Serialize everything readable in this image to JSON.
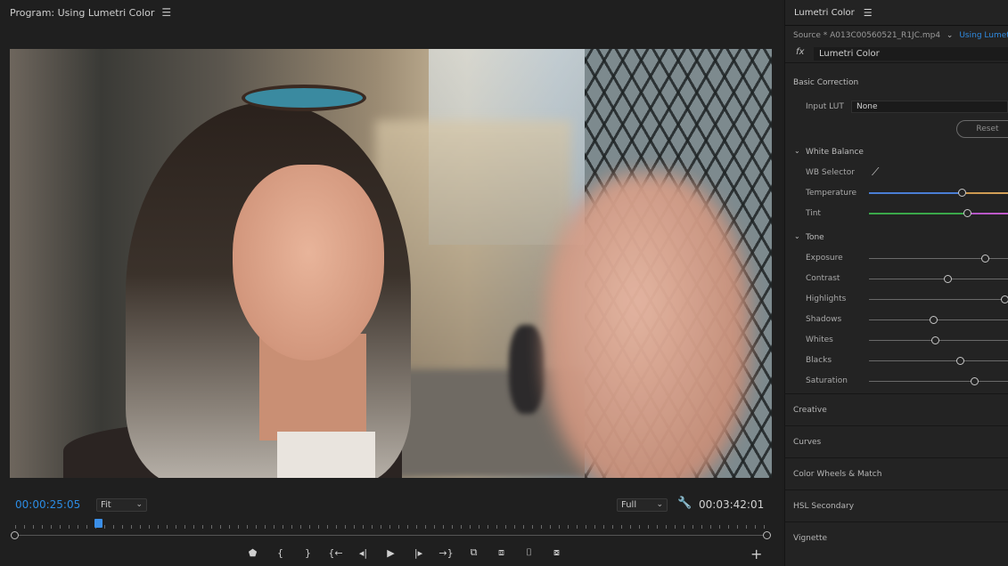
{
  "program": {
    "title": "Program: Using Lumetri Color",
    "menu_icon": "☰",
    "timecode_current": "00:00:25:05",
    "fit_value": "Fit",
    "resolution_value": "Full",
    "timecode_duration": "00:03:42:01",
    "playhead_fraction": 0.11,
    "transport": [
      {
        "name": "add-marker-icon",
        "glyph": "⬟"
      },
      {
        "name": "mark-in-icon",
        "glyph": "{"
      },
      {
        "name": "mark-out-icon",
        "glyph": "}"
      },
      {
        "name": "go-to-in-icon",
        "glyph": "{←"
      },
      {
        "name": "step-back-icon",
        "glyph": "◂|"
      },
      {
        "name": "play-icon",
        "glyph": "▶"
      },
      {
        "name": "step-forward-icon",
        "glyph": "|▸"
      },
      {
        "name": "go-to-out-icon",
        "glyph": "→}"
      },
      {
        "name": "lift-icon",
        "glyph": "⧉"
      },
      {
        "name": "extract-icon",
        "glyph": "⧈"
      },
      {
        "name": "export-frame-icon",
        "glyph": "⌷"
      },
      {
        "name": "comparison-view-icon",
        "glyph": "⧇"
      }
    ],
    "add_button": "+"
  },
  "lumetri": {
    "title": "Lumetri Color",
    "menu_icon": "☰",
    "source_label": "Source * A013C00560521_R1JC.mp4",
    "source_chevron": "⌄",
    "source_link": "Using Lumetri",
    "fx_label": "fx",
    "effect_name": "Lumetri Color",
    "basic_correction": "Basic Correction",
    "input_lut_label": "Input LUT",
    "input_lut_value": "None",
    "reset_label": "Reset",
    "white_balance": "White Balance",
    "wb_selector": "WB Selector",
    "temperature": {
      "label": "Temperature",
      "value": 0.67
    },
    "tint": {
      "label": "Tint",
      "value": 0.71
    },
    "tone": "Tone",
    "tone_sliders": [
      {
        "label": "Exposure",
        "value": 0.84
      },
      {
        "label": "Contrast",
        "value": 0.57
      },
      {
        "label": "Highlights",
        "value": 0.98
      },
      {
        "label": "Shadows",
        "value": 0.47
      },
      {
        "label": "Whites",
        "value": 0.48
      },
      {
        "label": "Blacks",
        "value": 0.66
      },
      {
        "label": "Saturation",
        "value": 0.76
      }
    ],
    "sections": [
      "Creative",
      "Curves",
      "Color Wheels & Match",
      "HSL Secondary",
      "Vignette"
    ]
  }
}
